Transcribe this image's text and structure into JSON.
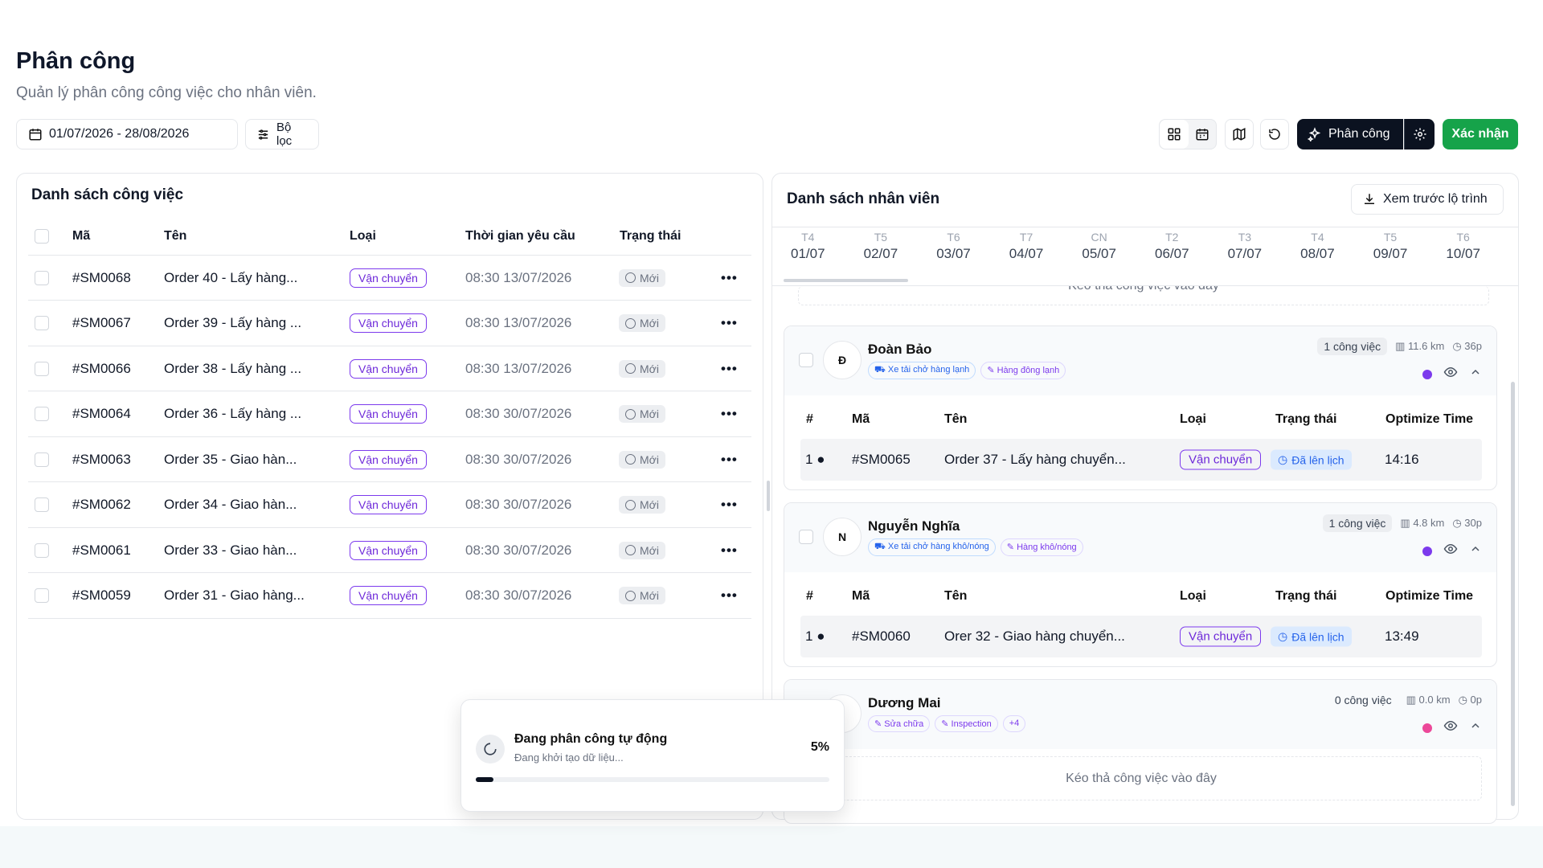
{
  "page": {
    "title": "Phân công",
    "subtitle": "Quản lý phân công công việc cho nhân viên."
  },
  "toolbar": {
    "date_range": "01/07/2026 - 28/08/2026",
    "filter_label": "Bộ lọc",
    "assign_label": "Phân công",
    "confirm_label": "Xác nhận",
    "view_icons": [
      "grid-icon",
      "calendar-icon",
      "map-icon",
      "refresh-icon",
      "sparkles-icon",
      "gear-icon"
    ]
  },
  "jobs": {
    "title": "Danh sách công việc",
    "headers": {
      "code": "Mã",
      "name": "Tên",
      "type": "Loại",
      "time": "Thời gian yêu cầu",
      "status": "Trạng thái"
    },
    "rows": [
      {
        "code": "#SM0068",
        "name": "Order 40 - Lấy hàng...",
        "type": "Vận chuyển",
        "time": "08:30 13/07/2026",
        "status": "Mới"
      },
      {
        "code": "#SM0067",
        "name": "Order 39 - Lấy hàng ...",
        "type": "Vận chuyển",
        "time": "08:30 13/07/2026",
        "status": "Mới"
      },
      {
        "code": "#SM0066",
        "name": "Order 38 - Lấy hàng ...",
        "type": "Vận chuyển",
        "time": "08:30 13/07/2026",
        "status": "Mới"
      },
      {
        "code": "#SM0064",
        "name": "Order 36 - Lấy hàng ...",
        "type": "Vận chuyển",
        "time": "08:30 30/07/2026",
        "status": "Mới"
      },
      {
        "code": "#SM0063",
        "name": "Order 35 - Giao hàn...",
        "type": "Vận chuyển",
        "time": "08:30 30/07/2026",
        "status": "Mới"
      },
      {
        "code": "#SM0062",
        "name": "Order 34 - Giao hàn...",
        "type": "Vận chuyển",
        "time": "08:30 30/07/2026",
        "status": "Mới"
      },
      {
        "code": "#SM0061",
        "name": "Order 33 - Giao hàn...",
        "type": "Vận chuyển",
        "time": "08:30 30/07/2026",
        "status": "Mới"
      },
      {
        "code": "#SM0059",
        "name": "Order 31 - Giao hàng...",
        "type": "Vận chuyển",
        "time": "08:30 30/07/2026",
        "status": "Mới"
      }
    ]
  },
  "staff": {
    "title": "Danh sách nhân viên",
    "preview_label": "Xem trước lộ trình",
    "days": [
      {
        "dow": "T4",
        "date": "01/07"
      },
      {
        "dow": "T5",
        "date": "02/07"
      },
      {
        "dow": "T6",
        "date": "03/07"
      },
      {
        "dow": "T7",
        "date": "04/07"
      },
      {
        "dow": "CN",
        "date": "05/07"
      },
      {
        "dow": "T2",
        "date": "06/07"
      },
      {
        "dow": "T3",
        "date": "07/07"
      },
      {
        "dow": "T4",
        "date": "08/07"
      },
      {
        "dow": "T5",
        "date": "09/07"
      },
      {
        "dow": "T6",
        "date": "10/07"
      }
    ],
    "drop_hint": "Kéo thả công việc vào đây",
    "table_headers": {
      "num": "#",
      "code": "Mã",
      "name": "Tên",
      "type": "Loại",
      "status": "Trạng thái",
      "opt": "Optimize Time"
    },
    "employees": [
      {
        "initial": "Đ",
        "name": "Đoàn Bảo",
        "count": "1 công việc",
        "distance": "11.6 km",
        "duration": "36p",
        "tags": [
          "Xe tải chở hàng lạnh",
          "Hàng đông lạnh"
        ],
        "dot_color": "#7c3aed",
        "job": {
          "num": "1",
          "code": "#SM0065",
          "name": "Order 37 - Lấy hàng chuyển...",
          "type": "Vận chuyển",
          "status": "Đã lên lịch",
          "opt": "14:16"
        }
      },
      {
        "initial": "N",
        "name": "Nguyễn Nghĩa",
        "count": "1 công việc",
        "distance": "4.8 km",
        "duration": "30p",
        "tags": [
          "Xe tải chở hàng khô/nóng",
          "Hàng khô/nóng"
        ],
        "dot_color": "#7c3aed",
        "job": {
          "num": "1",
          "code": "#SM0060",
          "name": "Orer 32 - Giao hàng chuyển...",
          "type": "Vận chuyển",
          "status": "Đã lên lịch",
          "opt": "13:49"
        }
      },
      {
        "initial": "",
        "name": "Dương Mai",
        "count": "0 công việc",
        "distance": "0.0 km",
        "duration": "0p",
        "tags": [
          "Sửa chữa",
          "Inspection",
          "+4"
        ],
        "dot_color": "#ec4899"
      }
    ]
  },
  "toast": {
    "title": "Đang phân công tự động",
    "subtitle": "Đang khởi tạo dữ liệu...",
    "percent": "5%",
    "progress": 0.05
  }
}
